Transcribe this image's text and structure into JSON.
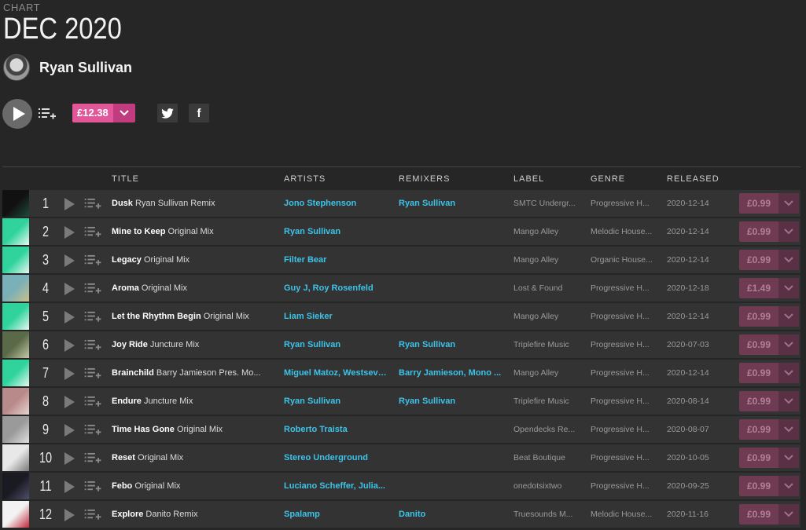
{
  "header": {
    "kicker": "CHART",
    "title": "DEC 2020",
    "artist": "Ryan Sullivan"
  },
  "actions": {
    "price": "£12.38",
    "play_icon": "play-icon",
    "queue_icon": "add-to-queue-icon"
  },
  "colors": {
    "background": "#262626",
    "row": "#333333",
    "accent_pink": "#e2569a",
    "link_blue": "#3ec3e8"
  },
  "columns": {
    "title": "TITLE",
    "artists": "ARTISTS",
    "remixers": "REMIXERS",
    "label": "LABEL",
    "genre": "GENRE",
    "released": "RELEASED"
  },
  "tracks": [
    {
      "num": "1",
      "name": "Dusk",
      "mix": "Ryan Sullivan Remix",
      "artists": "Jono Stephenson",
      "remixers": "Ryan Sullivan",
      "label": "SMTC Undergr...",
      "genre": "Progressive H...",
      "released": "2020-12-14",
      "price": "£0.99",
      "art": [
        "#111",
        "#1f4a3a"
      ]
    },
    {
      "num": "2",
      "name": "Mine to Keep",
      "mix": "Original Mix",
      "artists": "Ryan Sullivan",
      "remixers": "",
      "label": "Mango Alley",
      "genre": "Melodic House...",
      "released": "2020-12-14",
      "price": "£0.99",
      "art": [
        "#2fd39b",
        "#e8f7f1"
      ]
    },
    {
      "num": "3",
      "name": "Legacy",
      "mix": "Original Mix",
      "artists": "Filter Bear",
      "remixers": "",
      "label": "Mango Alley",
      "genre": "Organic House...",
      "released": "2020-12-14",
      "price": "£0.99",
      "art": [
        "#2fd39b",
        "#e8f7f1"
      ]
    },
    {
      "num": "4",
      "name": "Aroma",
      "mix": "Original Mix",
      "artists": "Guy J, Roy Rosenfeld",
      "remixers": "",
      "label": "Lost & Found",
      "genre": "Progressive H...",
      "released": "2020-12-18",
      "price": "£1.49",
      "art": [
        "#7ab0b8",
        "#c7c08a"
      ]
    },
    {
      "num": "5",
      "name": "Let the Rhythm Begin",
      "mix": "Original Mix",
      "artists": "Liam Sieker",
      "remixers": "",
      "label": "Mango Alley",
      "genre": "Progressive H...",
      "released": "2020-12-14",
      "price": "£0.99",
      "art": [
        "#2fd39b",
        "#e8f7f1"
      ]
    },
    {
      "num": "6",
      "name": "Joy Ride",
      "mix": "Juncture Mix",
      "artists": "Ryan Sullivan",
      "remixers": "Ryan Sullivan",
      "label": "Triplefire Music",
      "genre": "Progressive H...",
      "released": "2020-07-03",
      "price": "£0.99",
      "art": [
        "#5a6a48",
        "#c4c9a8"
      ]
    },
    {
      "num": "7",
      "name": "Brainchild",
      "mix": "Barry Jamieson Pres. Mo...",
      "artists": "Miguel Matoz, Westseven",
      "remixers": "Barry Jamieson, Mono ...",
      "label": "Mango Alley",
      "genre": "Progressive H...",
      "released": "2020-12-14",
      "price": "£0.99",
      "art": [
        "#2fd39b",
        "#e8f7f1"
      ]
    },
    {
      "num": "8",
      "name": "Endure",
      "mix": "Juncture Mix",
      "artists": "Ryan Sullivan",
      "remixers": "Ryan Sullivan",
      "label": "Triplefire Music",
      "genre": "Progressive H...",
      "released": "2020-08-14",
      "price": "£0.99",
      "art": [
        "#b98a8a",
        "#e8d3d0"
      ]
    },
    {
      "num": "9",
      "name": "Time Has Gone",
      "mix": "Original Mix",
      "artists": "Roberto Traista",
      "remixers": "",
      "label": "Opendecks Re...",
      "genre": "Progressive H...",
      "released": "2020-08-07",
      "price": "£0.99",
      "art": [
        "#9a9a9a",
        "#e0e0e0"
      ]
    },
    {
      "num": "10",
      "name": "Reset",
      "mix": "Original Mix",
      "artists": "Stereo Underground",
      "remixers": "",
      "label": "Beat Boutique",
      "genre": "Progressive H...",
      "released": "2020-10-05",
      "price": "£0.99",
      "art": [
        "#e8e8e8",
        "#7a7a7a"
      ]
    },
    {
      "num": "11",
      "name": "Febo",
      "mix": "Original Mix",
      "artists": "Luciano Scheffer, Julia...",
      "remixers": "",
      "label": "onedotsixtwo",
      "genre": "Progressive H...",
      "released": "2020-09-25",
      "price": "£0.99",
      "art": [
        "#1a1a22",
        "#4e4e6a"
      ]
    },
    {
      "num": "12",
      "name": "Explore",
      "mix": "Danito Remix",
      "artists": "Spalamp",
      "remixers": "Danito",
      "label": "Truesounds M...",
      "genre": "Melodic House...",
      "released": "2020-11-16",
      "price": "£0.99",
      "art": [
        "#f2f2f2",
        "#c0283c"
      ]
    }
  ]
}
